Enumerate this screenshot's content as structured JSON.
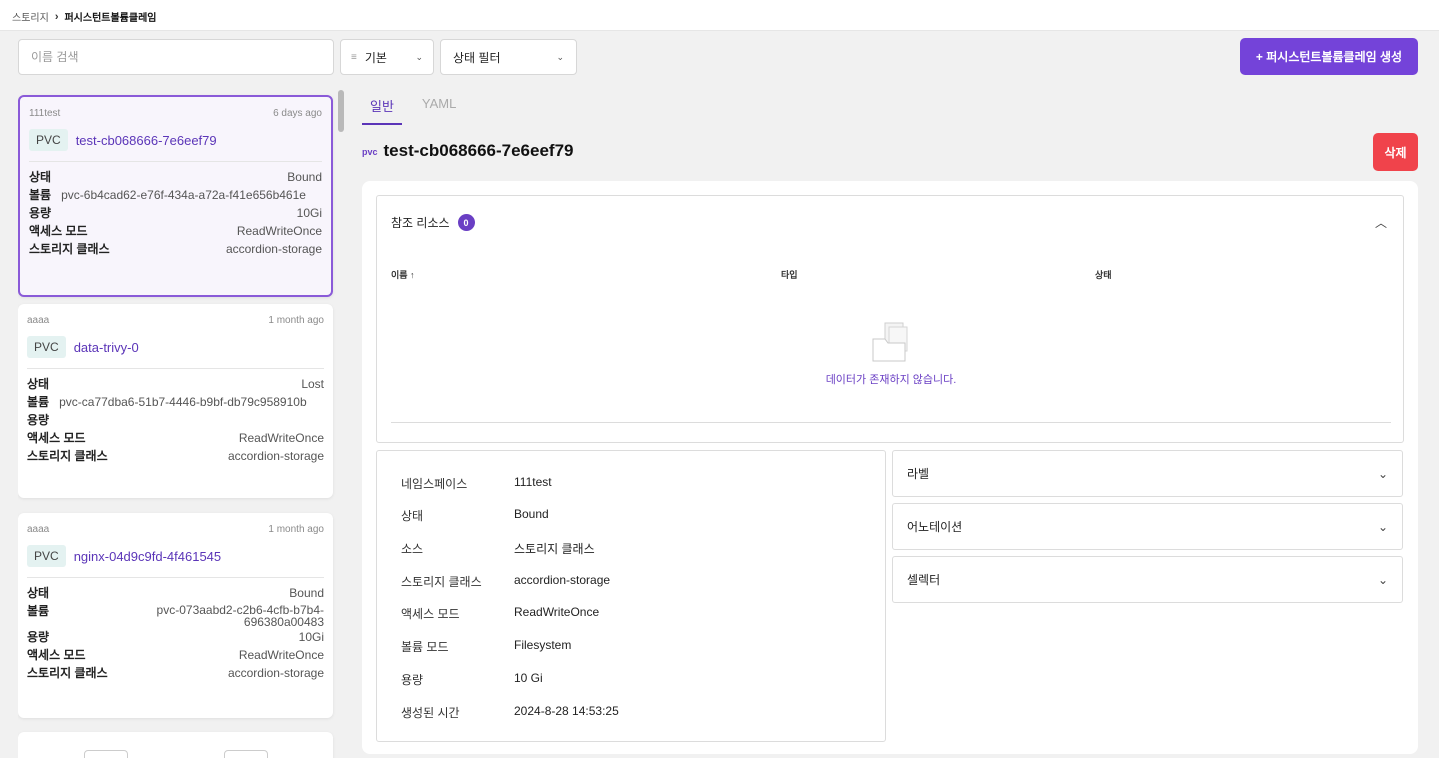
{
  "breadcrumb": {
    "root": "스토리지",
    "separator": "›",
    "current": "퍼시스턴트볼륨클레임"
  },
  "toolbar": {
    "search_placeholder": "이름 검색",
    "sort_label": "기본",
    "filter_label": "상태 필터",
    "create_label": "+ 퍼시스턴트볼륨클레임 생성"
  },
  "cards": [
    {
      "namespace": "111test",
      "age": "6 days ago",
      "tag": "PVC",
      "name": "test-cb068666-7e6eef79",
      "rows": [
        {
          "k": "상태",
          "v": "Bound"
        },
        {
          "k": "볼륨",
          "v": "pvc-6b4cad62-e76f-434a-a72a-f41e656b461e"
        },
        {
          "k": "용량",
          "v": "10Gi"
        },
        {
          "k": "액세스 모드",
          "v": "ReadWriteOnce"
        },
        {
          "k": "스토리지 클래스",
          "v": "accordion-storage"
        }
      ]
    },
    {
      "namespace": "aaaa",
      "age": "1 month ago",
      "tag": "PVC",
      "name": "data-trivy-0",
      "rows": [
        {
          "k": "상태",
          "v": "Lost"
        },
        {
          "k": "볼륨",
          "v": "pvc-ca77dba6-51b7-4446-b9bf-db79c958910b"
        },
        {
          "k": "용량",
          "v": ""
        },
        {
          "k": "액세스 모드",
          "v": "ReadWriteOnce"
        },
        {
          "k": "스토리지 클래스",
          "v": "accordion-storage"
        }
      ]
    },
    {
      "namespace": "aaaa",
      "age": "1 month ago",
      "tag": "PVC",
      "name": "nginx-04d9c9fd-4f461545",
      "rows": [
        {
          "k": "상태",
          "v": "Bound"
        },
        {
          "k": "볼륨",
          "v": "pvc-073aabd2-c2b6-4cfb-b7b4-696380a00483"
        },
        {
          "k": "용량",
          "v": "10Gi"
        },
        {
          "k": "액세스 모드",
          "v": "ReadWriteOnce"
        },
        {
          "k": "스토리지 클래스",
          "v": "accordion-storage"
        }
      ]
    }
  ],
  "tabs": [
    {
      "label": "일반"
    },
    {
      "label": "YAML"
    }
  ],
  "detail": {
    "tag": "pvc",
    "name": "test-cb068666-7e6eef79",
    "delete_label": "삭제",
    "ref": {
      "title": "참조 리소스",
      "count": "0",
      "columns": [
        "이름 ↑",
        "타입",
        "상태"
      ],
      "empty": "데이터가 존재하지 않습니다."
    },
    "info": [
      {
        "k": "네임스페이스",
        "v": "111test"
      },
      {
        "k": "상태",
        "v": "Bound"
      },
      {
        "k": "소스",
        "v": "스토리지 클래스"
      },
      {
        "k": "스토리지 클래스",
        "v": "accordion-storage"
      },
      {
        "k": "액세스 모드",
        "v": "ReadWriteOnce"
      },
      {
        "k": "볼륨 모드",
        "v": "Filesystem"
      },
      {
        "k": "용량",
        "v": "10 Gi"
      },
      {
        "k": "생성된 시간",
        "v": "2024-8-28 14:53:25"
      }
    ],
    "accordions": [
      {
        "label": "라벨"
      },
      {
        "label": "어노테이션"
      },
      {
        "label": "셀렉터"
      }
    ]
  }
}
